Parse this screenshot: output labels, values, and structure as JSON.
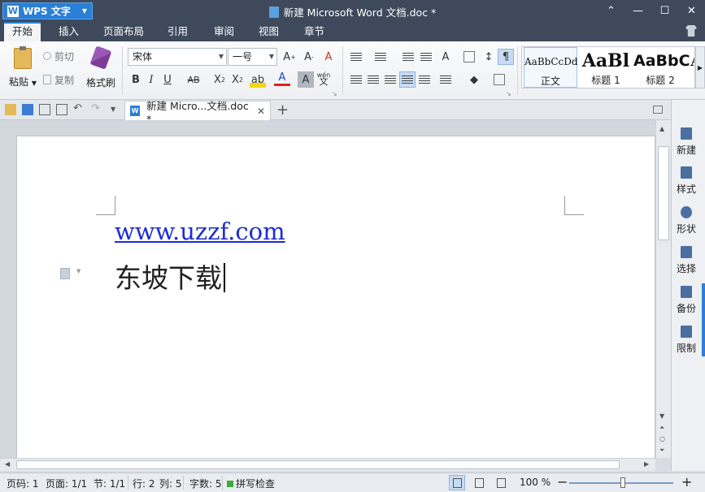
{
  "app": {
    "name": "WPS 文字",
    "window_title": "新建 Microsoft Word 文档.doc *"
  },
  "window_controls": {
    "restore": "⌃",
    "minimize": "—",
    "maximize": "☐",
    "close": "✕"
  },
  "menu_tabs": [
    {
      "label": "开始",
      "active": true
    },
    {
      "label": "插入"
    },
    {
      "label": "页面布局"
    },
    {
      "label": "引用"
    },
    {
      "label": "审阅"
    },
    {
      "label": "视图"
    },
    {
      "label": "章节"
    }
  ],
  "ribbon": {
    "paste_label": "粘贴",
    "cut_label": "剪切",
    "copy_label": "复制",
    "format_painter_label": "格式刷",
    "font_name": "宋体",
    "font_size": "一号",
    "styles": [
      {
        "sample": "AaBbCcDd",
        "name": "正文"
      },
      {
        "sample": "AaBl",
        "name": "标题 1"
      },
      {
        "sample": "AaBbC",
        "name": "标题 2"
      },
      {
        "sample": "A",
        "name": ""
      }
    ],
    "pinyin_label": "wén"
  },
  "doc_tab": {
    "title": "新建 Micro...文档.doc *"
  },
  "document": {
    "link_text": "www.uzzf.com",
    "body_text": "东坡下载"
  },
  "task_pane": [
    {
      "label": "新建",
      "icon": "new-doc-icon"
    },
    {
      "label": "样式",
      "icon": "style-icon"
    },
    {
      "label": "形状",
      "icon": "shape-icon"
    },
    {
      "label": "选择",
      "icon": "select-icon"
    },
    {
      "label": "备份",
      "icon": "backup-icon"
    },
    {
      "label": "限制",
      "icon": "restrict-icon"
    }
  ],
  "status": {
    "page_code": "页码: 1",
    "page": "页面: 1/1",
    "section": "节: 1/1",
    "row": "行: 2",
    "col": "列: 5",
    "words": "字数: 5",
    "spell": "拼写检查",
    "zoom": "100 %"
  },
  "colors": {
    "accent": "#2a7fd6",
    "titlebar": "#3e4a5b",
    "link": "#1c2bd6"
  }
}
